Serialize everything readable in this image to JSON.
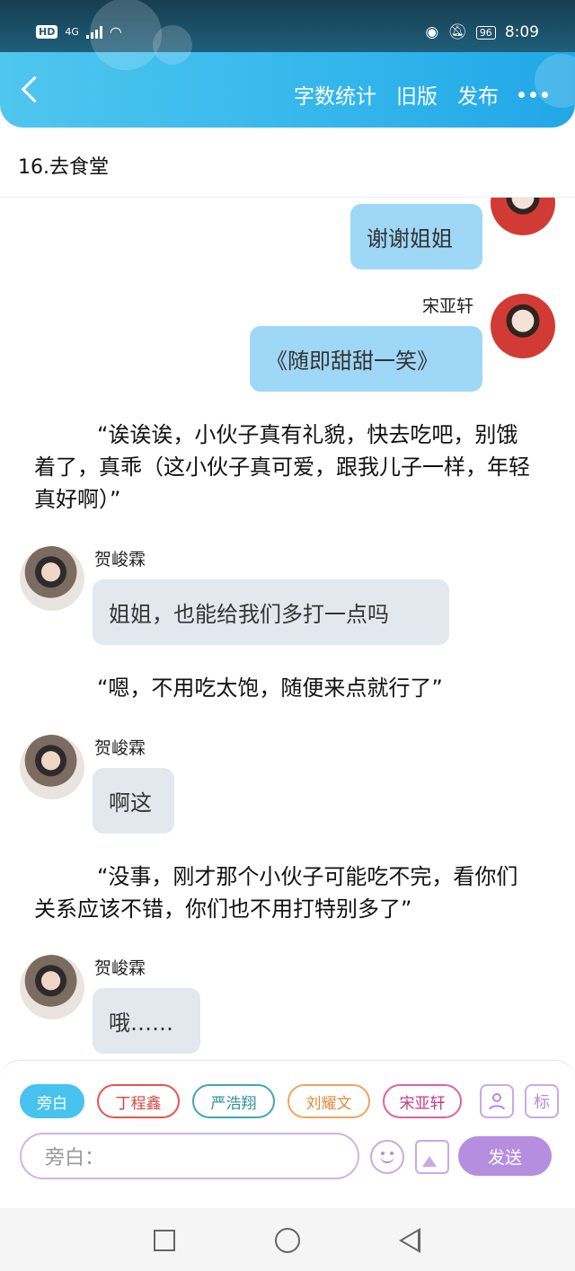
{
  "status": {
    "network": "4G",
    "hd_label": "HD",
    "battery": "96",
    "time": "8:09"
  },
  "header": {
    "actions": [
      "字数统计",
      "旧版",
      "发布"
    ]
  },
  "chapter_title": "16.去食堂",
  "messages": [
    {
      "type": "right",
      "name": "",
      "text": "谢谢姐姐"
    },
    {
      "type": "right",
      "name": "宋亚轩",
      "text": "《随即甜甜一笑》"
    },
    {
      "type": "narration",
      "text": "“诶诶诶，小伙子真有礼貌，快去吃吧，别饿着了，真乖（这小伙子真可爱，跟我儿子一样，年轻真好啊）”"
    },
    {
      "type": "left",
      "name": "贺峻霖",
      "text": "姐姐，也能给我们多打一点吗"
    },
    {
      "type": "narration",
      "text": "“嗯，不用吃太饱，随便来点就行了”"
    },
    {
      "type": "left",
      "name": "贺峻霖",
      "text": "啊这"
    },
    {
      "type": "narration",
      "text": "“没事，刚才那个小伙子可能吃不完，看你们关系应该不错，你们也不用打特别多了”"
    },
    {
      "type": "left",
      "name": "贺峻霖",
      "text": "哦……"
    }
  ],
  "composer": {
    "roles": [
      "旁白",
      "丁程鑫",
      "严浩翔",
      "刘耀文",
      "宋亚轩"
    ],
    "mark_label": "标",
    "input_placeholder": "旁白：",
    "send_label": "发送"
  },
  "colors": {
    "header_gradient_start": "#4fc6ee",
    "header_gradient_end": "#22a7e6",
    "right_bubble": "#9fd8f6",
    "left_bubble": "#e3e8ef",
    "send_button": "#b68ee0"
  }
}
